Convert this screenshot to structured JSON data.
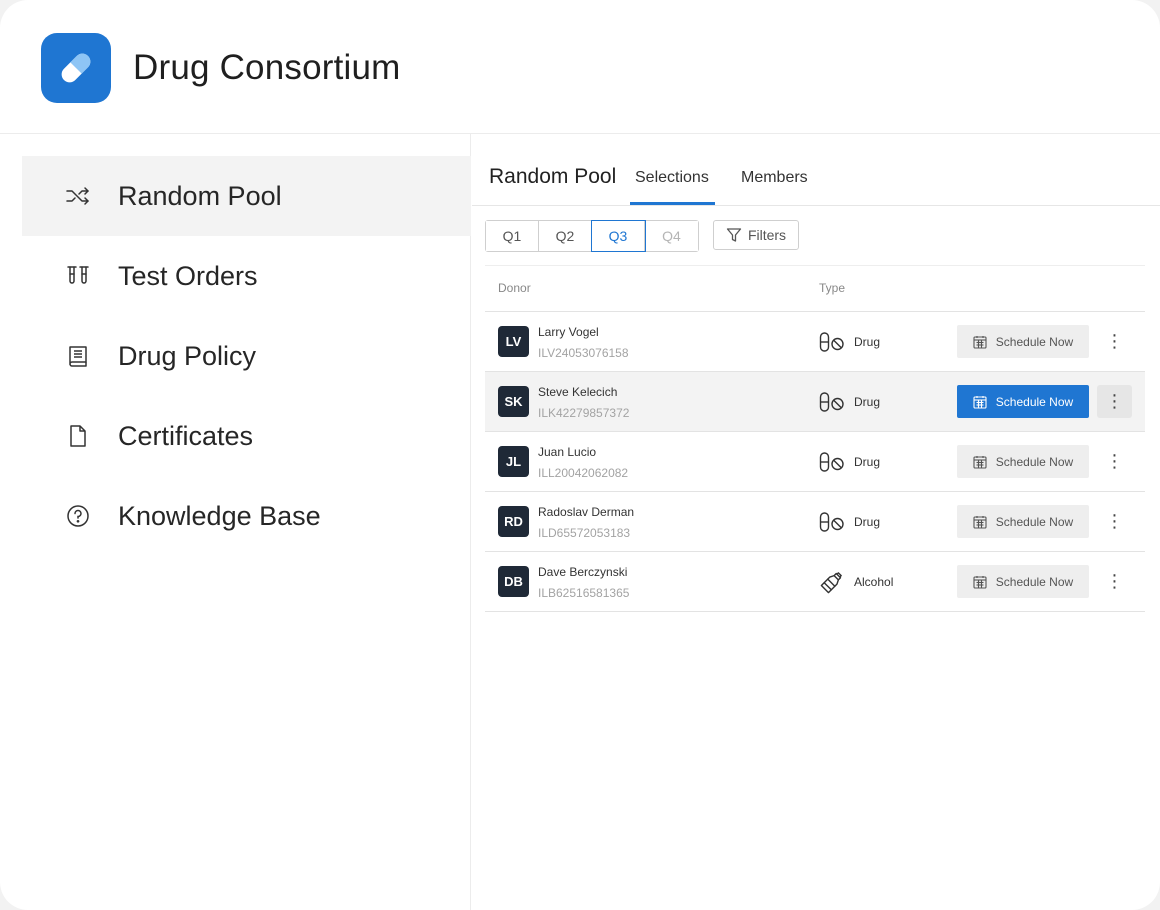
{
  "app": {
    "title": "Drug Consortium",
    "accent": "#1f76d2"
  },
  "sidebar": {
    "items": [
      {
        "label": "Random Pool",
        "icon": "shuffle-icon",
        "active": true
      },
      {
        "label": "Test Orders",
        "icon": "test-tubes-icon"
      },
      {
        "label": "Drug Policy",
        "icon": "book-icon"
      },
      {
        "label": "Certificates",
        "icon": "document-icon"
      },
      {
        "label": "Knowledge Base",
        "icon": "help-circle-icon"
      }
    ]
  },
  "main": {
    "section_title": "Random Pool",
    "tabs": [
      {
        "label": "Selections",
        "active": true
      },
      {
        "label": "Members"
      }
    ],
    "quarters": [
      {
        "label": "Q1"
      },
      {
        "label": "Q2"
      },
      {
        "label": "Q3",
        "active": true
      },
      {
        "label": "Q4",
        "disabled": true
      }
    ],
    "filters_label": "Filters",
    "table": {
      "headers": {
        "donor": "Donor",
        "type": "Type"
      },
      "rows": [
        {
          "initials": "LV",
          "name": "Larry Vogel",
          "id": "ILV24053076158",
          "type": "Drug",
          "type_icon": "capsule-no-icon",
          "action": "Schedule Now"
        },
        {
          "initials": "SK",
          "name": "Steve Kelecich",
          "id": "ILK42279857372",
          "type": "Drug",
          "type_icon": "capsule-no-icon",
          "action": "Schedule Now"
        },
        {
          "initials": "JL",
          "name": "Juan Lucio",
          "id": "ILL20042062082",
          "type": "Drug",
          "type_icon": "capsule-no-icon",
          "action": "Schedule Now"
        },
        {
          "initials": "RD",
          "name": "Radoslav Derman",
          "id": "ILD65572053183",
          "type": "Drug",
          "type_icon": "capsule-no-icon",
          "action": "Schedule Now"
        },
        {
          "initials": "DB",
          "name": "Dave Berczynski",
          "id": "ILB62516581365",
          "type": "Alcohol",
          "type_icon": "bottle-icon",
          "action": "Schedule Now"
        }
      ]
    }
  }
}
